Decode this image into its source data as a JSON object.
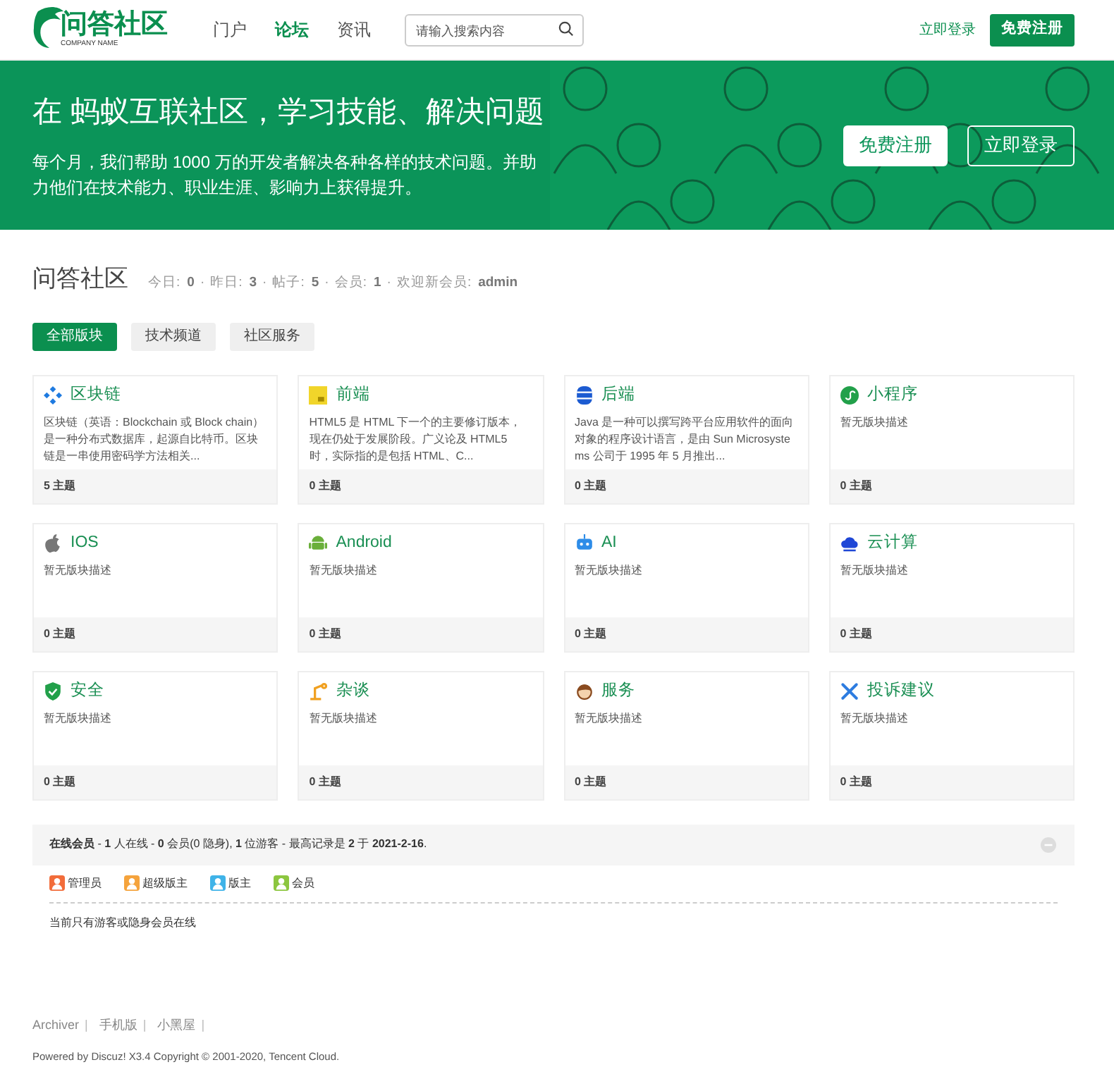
{
  "header": {
    "logo_text": "问答社区",
    "logo_subtext": "COMPANY NAME",
    "nav": [
      {
        "label": "门户",
        "selected": false
      },
      {
        "label": "论坛",
        "selected": true
      },
      {
        "label": "资讯",
        "selected": false
      }
    ],
    "search": {
      "placeholder": "请输入搜索内容"
    },
    "login": "立即登录",
    "register": "免费注册"
  },
  "banner": {
    "title": "在 蚂蚁互联社区，学习技能、解决问题",
    "text": "每个月，我们帮助 1000 万的开发者解决各种各样的技术问题。并助力他们在技术能力、职业生涯、影响力上获得提升。",
    "register": "免费注册",
    "login": "立即登录"
  },
  "section": {
    "title": "问答社区",
    "separator": "·",
    "stats": [
      {
        "label": "今日:",
        "value": "0"
      },
      {
        "label": "昨日:",
        "value": "3"
      },
      {
        "label": "帖子:",
        "value": "5"
      },
      {
        "label": "会员:",
        "value": "1"
      },
      {
        "label": "欢迎新会员:",
        "value": "admin"
      }
    ]
  },
  "tabs": [
    {
      "label": "全部版块",
      "selected": true
    },
    {
      "label": "技术频道",
      "selected": false
    },
    {
      "label": "社区服务",
      "selected": false
    }
  ],
  "forums": [
    {
      "name": "区块链",
      "description": "区块链（英语：Blockchain 或 Block chain）是一种分布式数据库，起源自比特币。区块链是一串使用密码学方法相关...",
      "count": "5 主题"
    },
    {
      "name": "前端",
      "description": "HTML5 是 HTML 下一个的主要修订版本，现在仍处于发展阶段。广义论及 HTML5 时，实际指的是包括 HTML、C...",
      "count": "0 主题"
    },
    {
      "name": "后端",
      "description": "Java 是一种可以撰写跨平台应用软件的面向对象的程序设计语言，是由 Sun Microsystems 公司于 1995 年 5 月推出...",
      "count": "0 主题"
    },
    {
      "name": "小程序",
      "description": "暂无版块描述",
      "count": "0 主题"
    },
    {
      "name": "IOS",
      "description": "暂无版块描述",
      "count": "0 主题"
    },
    {
      "name": "Android",
      "description": "暂无版块描述",
      "count": "0 主题"
    },
    {
      "name": "AI",
      "description": "暂无版块描述",
      "count": "0 主题"
    },
    {
      "name": "云计算",
      "description": "暂无版块描述",
      "count": "0 主题"
    },
    {
      "name": "安全",
      "description": "暂无版块描述",
      "count": "0 主题"
    },
    {
      "name": "杂谈",
      "description": "暂无版块描述",
      "count": "0 主题"
    },
    {
      "name": "服务",
      "description": "暂无版块描述",
      "count": "0 主题"
    },
    {
      "name": "投诉建议",
      "description": "暂无版块描述",
      "count": "0 主题"
    }
  ],
  "online": {
    "summary": "**在线会员** - **1** 人在线 - **0** 会员(0 隐身), **1** 位游客 - 最高记录是 **2** 于 **2021-2-16**.",
    "legend": [
      {
        "label": "管理员",
        "color": "#f26c3a"
      },
      {
        "label": "超级版主",
        "color": "#f5a33c"
      },
      {
        "label": "版主",
        "color": "#3fb3e8"
      },
      {
        "label": "会员",
        "color": "#8cc63f"
      }
    ],
    "note": "当前只有游客或隐身会员在线"
  },
  "footer": {
    "links": [
      "Archiver",
      "手机版",
      "小黑屋"
    ],
    "separator": "|",
    "copyright": "Powered by Discuz! X3.4 Copyright © 2001-2020, Tencent Cloud."
  }
}
